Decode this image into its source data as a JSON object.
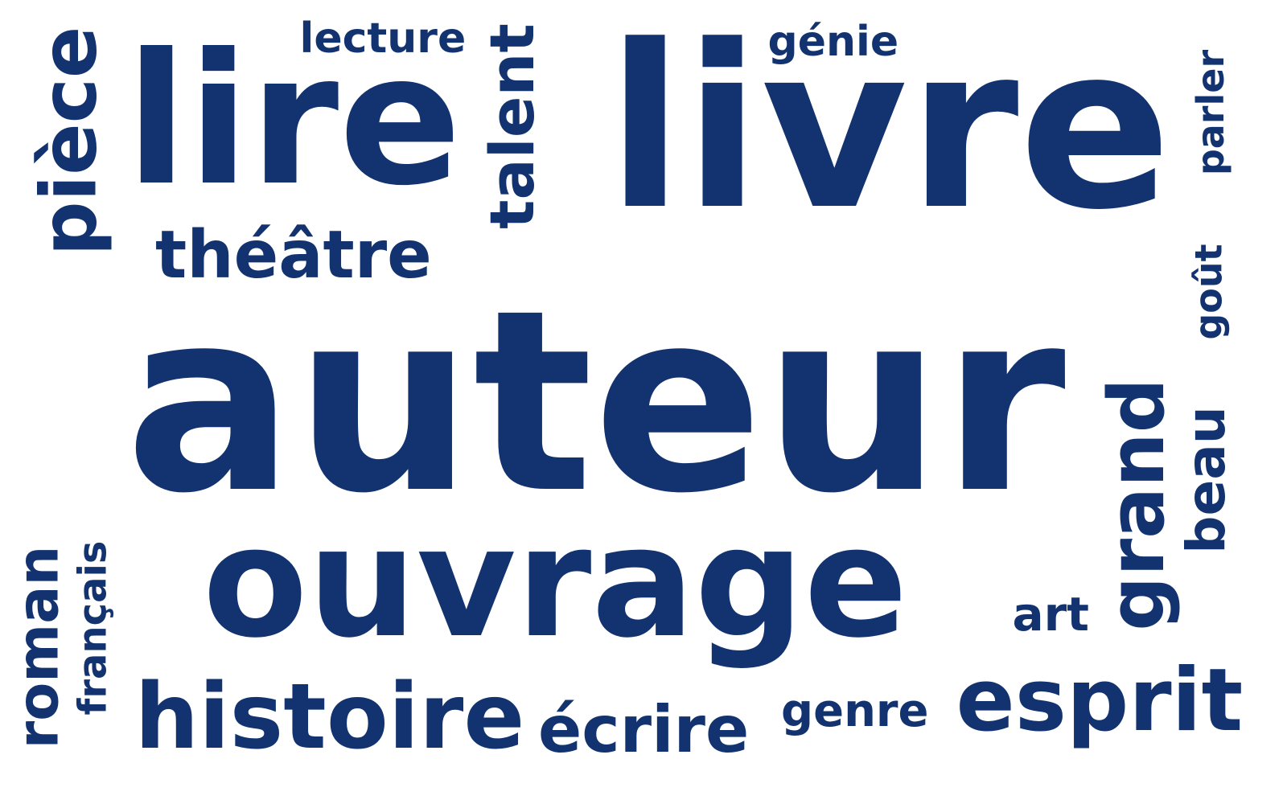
{
  "words": [
    {
      "text": "auteur"
    },
    {
      "text": "livre"
    },
    {
      "text": "ouvrage"
    },
    {
      "text": "lire"
    },
    {
      "text": "histoire"
    },
    {
      "text": "théâtre"
    },
    {
      "text": "esprit"
    },
    {
      "text": "pièce"
    },
    {
      "text": "talent"
    },
    {
      "text": "grand"
    },
    {
      "text": "roman"
    },
    {
      "text": "écrire"
    },
    {
      "text": "lecture"
    },
    {
      "text": "génie"
    },
    {
      "text": "genre"
    },
    {
      "text": "parler"
    },
    {
      "text": "beau"
    },
    {
      "text": "français"
    },
    {
      "text": "goût"
    },
    {
      "text": "art"
    }
  ],
  "colors": {
    "text": "#12336f",
    "background": "#ffffff"
  }
}
